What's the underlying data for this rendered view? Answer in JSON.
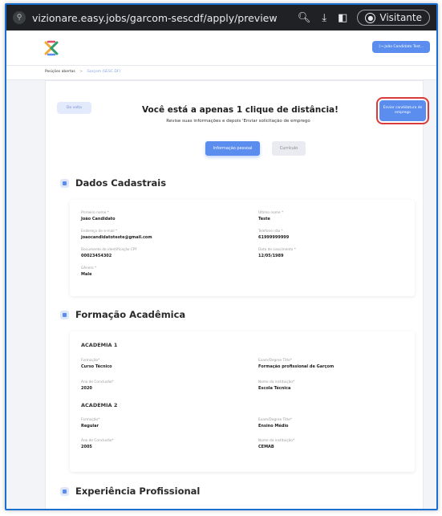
{
  "browser": {
    "url": "vizionare.easy.jobs/garcom-sescdf/apply/preview",
    "visitor_label": "Visitante"
  },
  "header": {
    "user_button": "[→ João Candidato Test..."
  },
  "breadcrumb": {
    "root": "Posições abertas",
    "separator": ">",
    "current": "Garçom (SESC DF)"
  },
  "hero": {
    "back_button": "De volta",
    "title": "Você está a apenas 1 clique de distância!",
    "subtitle": "Revise suas informações e depois 'Enviar solicitação de emprego",
    "send_button": "Enviar candidatura de emprego",
    "tab_personal": "Informação pessoal",
    "tab_cv": "Currículo"
  },
  "dados": {
    "heading": "Dados Cadastrais",
    "first_name_label": "Primeiro nome *",
    "first_name": "João Candidato",
    "last_name_label": "Último nome *",
    "last_name": "Teste",
    "email_label": "Endereço de e-mail *",
    "email": "joaocandidatoteste@gmail.com",
    "phone_label": "Telefone não *",
    "phone": "61999999999",
    "cpf_label": "Documento de identificação CPF",
    "cpf": "00023454302",
    "birth_label": "Data de nascimento *",
    "birth": "12/05/1989",
    "gender_label": "Gênero *",
    "gender": "Male"
  },
  "formacao": {
    "heading": "Formação Acadêmica",
    "academies": [
      {
        "title": "ACADEMIA 1",
        "formacao_label": "Formação*",
        "formacao": "Curso Técnico",
        "degree_label": "Exam/Degree Title*",
        "degree": "Formação profissional de Garçom",
        "year_label": "Ano de Conclusão*",
        "year": "2020",
        "institution_label": "Nome da instituição*",
        "institution": "Escola Técnica"
      },
      {
        "title": "ACADEMIA 2",
        "formacao_label": "Formação*",
        "formacao": "Regular",
        "degree_label": "Exam/Degree Title*",
        "degree": "Ensino Médio",
        "year_label": "Ano de Conclusão*",
        "year": "2005",
        "institution_label": "Nome da instituição*",
        "institution": "CEMAB"
      }
    ]
  },
  "experiencia": {
    "heading": "Experiência Profissional"
  },
  "colors": {
    "accent": "#5a8dee",
    "highlight": "#d93b3b",
    "browser_bar": "#202124"
  }
}
